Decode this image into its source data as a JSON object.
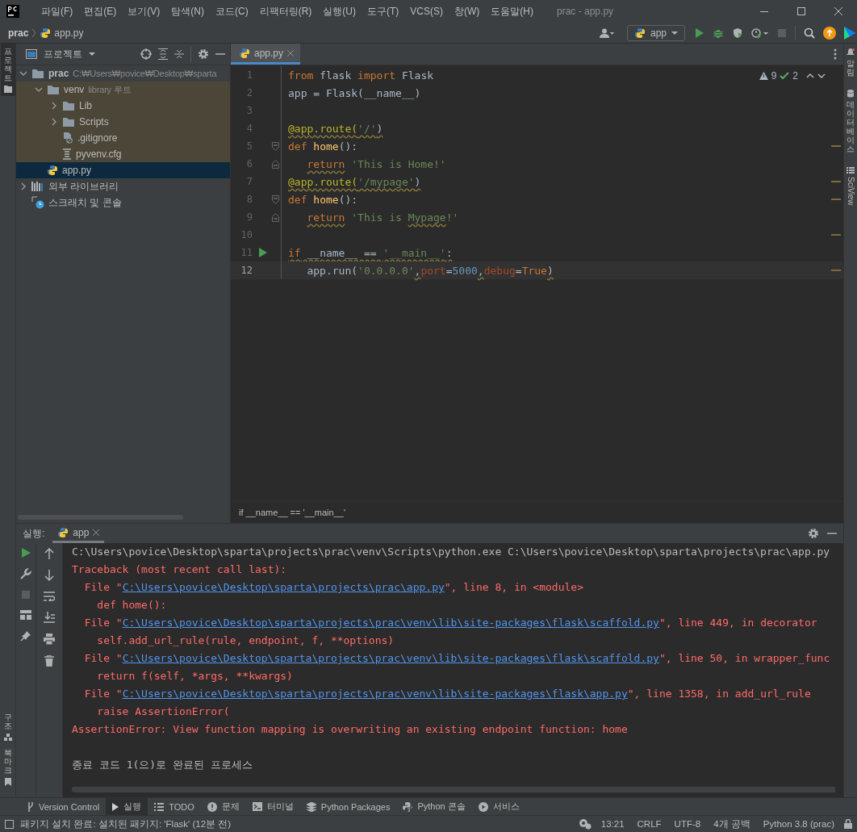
{
  "title_bar": {
    "menus": [
      "파일(F)",
      "편집(E)",
      "보기(V)",
      "탐색(N)",
      "코드(C)",
      "리팩터링(R)",
      "실행(U)",
      "도구(T)",
      "VCS(S)",
      "창(W)",
      "도움말(H)"
    ],
    "title": "prac - app.py"
  },
  "nav_bar": {
    "breadcrumb": [
      "prac",
      "app.py"
    ],
    "run_config": "app"
  },
  "left_strip": {
    "top": [
      {
        "label": "프로젝트",
        "selected": true
      }
    ],
    "bottom": [
      {
        "label": "구조",
        "selected": false
      },
      {
        "label": "북마크",
        "selected": false
      }
    ]
  },
  "right_strip": [
    {
      "label": "알림",
      "kind": "bell"
    },
    {
      "label": "데이터베이스",
      "kind": "database"
    },
    {
      "label": "SciView",
      "kind": "grid"
    }
  ],
  "project": {
    "title": "프로젝트",
    "tree": [
      {
        "name": "prac",
        "hint": "C:₩Users₩povice₩Desktop₩sparta",
        "kind": "folder",
        "expanded": true,
        "selected": false,
        "children": [
          {
            "name": "venv",
            "hint": "library 루트",
            "kind": "library-folder",
            "expanded": true,
            "selected": false,
            "children": [
              {
                "name": "Lib",
                "kind": "folder",
                "expanded": false,
                "selected": false
              },
              {
                "name": "Scripts",
                "kind": "folder",
                "expanded": false,
                "selected": false
              },
              {
                "name": ".gitignore",
                "kind": "ignore-file",
                "selected": false
              },
              {
                "name": "pyvenv.cfg",
                "kind": "text-file",
                "selected": false
              }
            ]
          },
          {
            "name": "app.py",
            "kind": "python-file",
            "selected": true
          }
        ]
      },
      {
        "name": "외부 라이브러리",
        "kind": "libraries",
        "expanded": false,
        "selected": false
      },
      {
        "name": "스크래치 및 콘솔",
        "kind": "scratches",
        "selected": false
      }
    ]
  },
  "editor": {
    "tab": {
      "label": "app.py",
      "selected": true
    },
    "warnings": "9",
    "weak_warnings": "2",
    "breadcrumb": "if __name__ == '__main__'",
    "lines": [
      {
        "no": "1",
        "tokens": [
          {
            "text": "from",
            "kind": "kw"
          },
          {
            "text": " flask ",
            "kind": "plain"
          },
          {
            "text": "import",
            "kind": "kw"
          },
          {
            "text": " Flask",
            "kind": "plain"
          }
        ]
      },
      {
        "no": "2",
        "tokens": [
          {
            "text": "app = Flask(__name__)",
            "kind": "plain"
          }
        ]
      },
      {
        "no": "3"
      },
      {
        "no": "4",
        "tokens": [
          {
            "text": "@app.route(",
            "kind": "dec",
            "warn": true
          },
          {
            "text": "'/'",
            "kind": "str",
            "warn": true
          },
          {
            "text": ")",
            "kind": "plain",
            "warn": true
          }
        ]
      },
      {
        "no": "5",
        "fold_start": true,
        "marked": true,
        "tokens": [
          {
            "text": "def",
            "kind": "kw"
          },
          {
            "text": " home",
            "kind": "fn"
          },
          {
            "text": "():",
            "kind": "plain"
          }
        ]
      },
      {
        "no": "6",
        "fold_end": true,
        "indent": true,
        "tokens": [
          {
            "text": "return",
            "kind": "kw",
            "warn": true
          },
          {
            "text": " 'This is Home!'",
            "kind": "str"
          }
        ]
      },
      {
        "no": "7",
        "marked": true,
        "tokens": [
          {
            "text": "@app.route(",
            "kind": "dec",
            "warn": true
          },
          {
            "text": "'/mypage'",
            "kind": "str",
            "warn": true
          },
          {
            "text": ")",
            "kind": "plain",
            "warn": true
          }
        ]
      },
      {
        "no": "8",
        "fold_start": true,
        "marked": true,
        "tokens": [
          {
            "text": "def",
            "kind": "kw"
          },
          {
            "text": " home",
            "kind": "fn"
          },
          {
            "text": "():",
            "kind": "plain"
          }
        ]
      },
      {
        "no": "9",
        "fold_end": true,
        "indent": true,
        "tokens": [
          {
            "text": "return",
            "kind": "kw",
            "warn": true
          },
          {
            "text": " 'This is ",
            "kind": "str"
          },
          {
            "text": "Mypage",
            "kind": "str",
            "warn": true
          },
          {
            "text": "!'",
            "kind": "str"
          }
        ]
      },
      {
        "no": "10",
        "marked": true
      },
      {
        "no": "11",
        "run": true,
        "tokens": [
          {
            "text": "if",
            "kind": "kw",
            "warn": true
          },
          {
            "text": " __name__ == ",
            "kind": "plain",
            "warn": true
          },
          {
            "text": "'__main__'",
            "kind": "str",
            "warn": true
          },
          {
            "text": ":",
            "kind": "plain",
            "warn": true
          }
        ]
      },
      {
        "no": "12",
        "current": true,
        "marked": true,
        "indent": true,
        "tokens": [
          {
            "text": "app.run(",
            "kind": "plain"
          },
          {
            "text": "'0.0.0.0'",
            "kind": "str"
          },
          {
            "text": ",",
            "kind": "plain",
            "warn": true
          },
          {
            "text": "port",
            "kind": "param"
          },
          {
            "text": "=",
            "kind": "plain"
          },
          {
            "text": "5000",
            "kind": "num"
          },
          {
            "text": ",",
            "kind": "plain",
            "warn": true
          },
          {
            "text": "debug",
            "kind": "param"
          },
          {
            "text": "=",
            "kind": "plain"
          },
          {
            "text": "True",
            "kind": "kw"
          },
          {
            "text": ")",
            "kind": "plain",
            "warn": true
          }
        ]
      }
    ]
  },
  "run_panel": {
    "label": "실행:",
    "tab": {
      "label": "app",
      "selected": true
    },
    "console": [
      [
        {
          "text": "C:\\Users\\povice\\Desktop\\sparta\\projects\\prac\\venv\\Scripts\\python.exe C:\\Users\\povice\\Desktop\\sparta\\projects\\prac\\app.py",
          "kind": "plain"
        }
      ],
      [
        {
          "text": "Traceback (most recent call last):",
          "kind": "err"
        }
      ],
      [
        {
          "text": "  File \"",
          "kind": "err"
        },
        {
          "text": "C:\\Users\\povice\\Desktop\\sparta\\projects\\prac\\app.py",
          "kind": "link"
        },
        {
          "text": "\", line 8, in <module>",
          "kind": "err"
        }
      ],
      [
        {
          "text": "    def home():",
          "kind": "err"
        }
      ],
      [
        {
          "text": "  File \"",
          "kind": "err"
        },
        {
          "text": "C:\\Users\\povice\\Desktop\\sparta\\projects\\prac\\venv\\lib\\site-packages\\flask\\scaffold.py",
          "kind": "link"
        },
        {
          "text": "\", line 449, in decorator",
          "kind": "err"
        }
      ],
      [
        {
          "text": "    self.add_url_rule(rule, endpoint, f, **options)",
          "kind": "err"
        }
      ],
      [
        {
          "text": "  File \"",
          "kind": "err"
        },
        {
          "text": "C:\\Users\\povice\\Desktop\\sparta\\projects\\prac\\venv\\lib\\site-packages\\flask\\scaffold.py",
          "kind": "link"
        },
        {
          "text": "\", line 50, in wrapper_func",
          "kind": "err"
        }
      ],
      [
        {
          "text": "    return f(self, *args, **kwargs)",
          "kind": "err"
        }
      ],
      [
        {
          "text": "  File \"",
          "kind": "err"
        },
        {
          "text": "C:\\Users\\povice\\Desktop\\sparta\\projects\\prac\\venv\\lib\\site-packages\\flask\\app.py",
          "kind": "link"
        },
        {
          "text": "\", line 1358, in add_url_rule",
          "kind": "err"
        }
      ],
      [
        {
          "text": "    raise AssertionError(",
          "kind": "err"
        }
      ],
      [
        {
          "text": "AssertionError: View function mapping is overwriting an existing endpoint function: home",
          "kind": "err"
        }
      ],
      [
        {
          "text": "종료 코드 1(으)로 완료된 프로세스",
          "kind": "plain",
          "gap_before": true
        }
      ]
    ]
  },
  "tool_bar": [
    {
      "label": "Version Control",
      "kind": "vcs",
      "selected": false
    },
    {
      "label": "실행",
      "kind": "run",
      "selected": true
    },
    {
      "label": "TODO",
      "kind": "todo",
      "selected": false
    },
    {
      "label": "문제",
      "kind": "problems",
      "selected": false
    },
    {
      "label": "터미널",
      "kind": "terminal",
      "selected": false
    },
    {
      "label": "Python Packages",
      "kind": "packages",
      "selected": false
    },
    {
      "label": "Python 콘솔",
      "kind": "console",
      "selected": false
    },
    {
      "label": "서비스",
      "kind": "services",
      "selected": false
    }
  ],
  "status_bar": {
    "message": "패키지 설치 완료: 설치된 패키지: 'Flask' (12분 전)",
    "items": [
      "13:21",
      "CRLF",
      "UTF-8",
      "4개 공백",
      "Python 3.8 (prac)"
    ]
  }
}
